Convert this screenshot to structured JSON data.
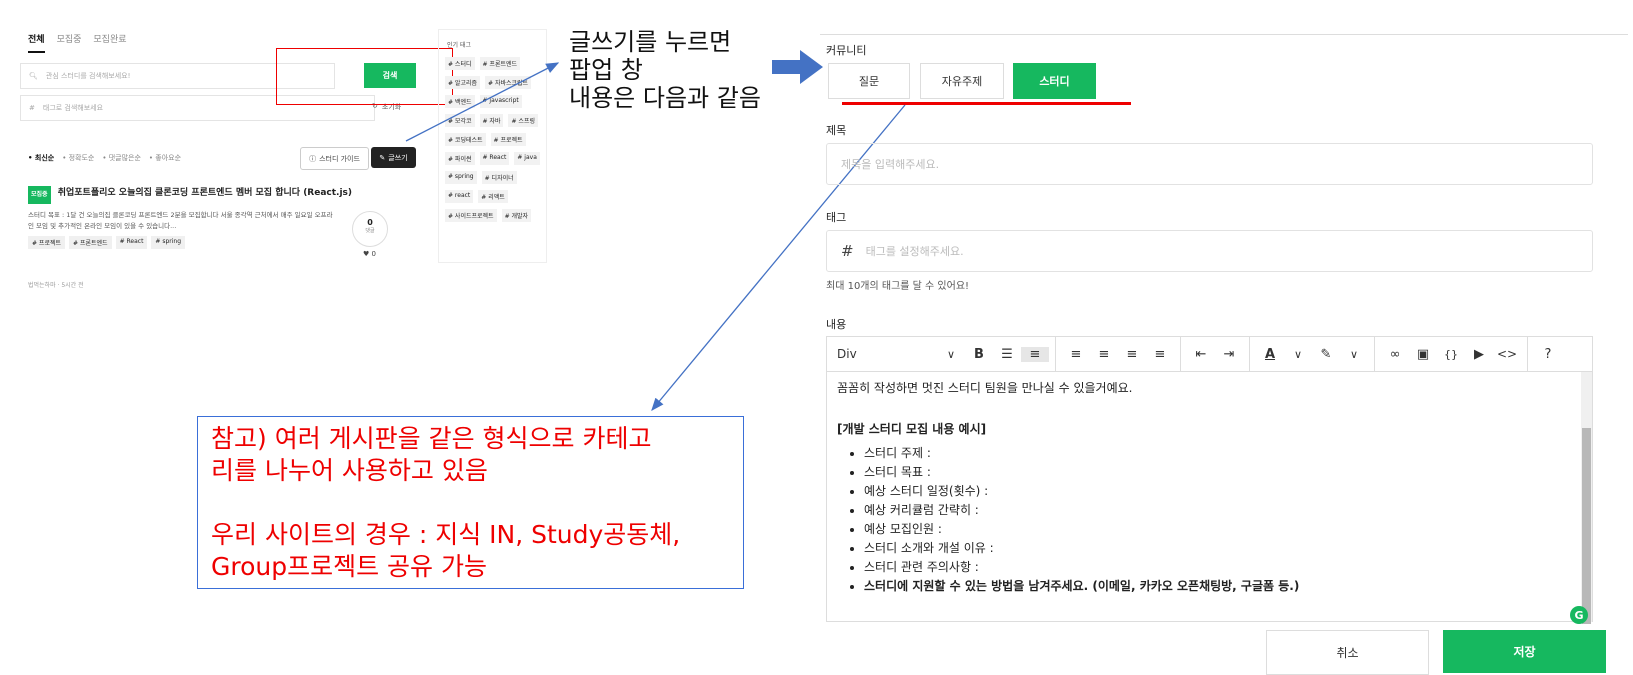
{
  "left": {
    "tabs": [
      "전체",
      "모집중",
      "모집완료"
    ],
    "search_placeholder": "관심 스터디를 검색해보세요!",
    "search_button": "검색",
    "tag_placeholder": "태그로 검색해보세요",
    "reset": "초기화",
    "sorts": [
      "• 최신순",
      "• 정확도순",
      "• 댓글많은순",
      "• 좋아요순"
    ],
    "guide_button": "스터디 가이드",
    "write_button": "글쓰기",
    "post": {
      "badge": "모집중",
      "title": "취업포트폴리오 오늘의집 클론코딩 프론트엔드 멤버 모집 합니다 (React.js)",
      "body": "스터디 목표 : 1달 건 오늘의집 클론코딩 프론트엔드 2분을 모집합니다 서울 종각역 근처에서 매주 일요일 오프라인 모임 및 추가적인 온라인 모임이 있을 수 있습니다...",
      "tags": [
        "# 프로젝트",
        "# 프론트엔드",
        "# React",
        "# spring"
      ],
      "comments_count": "0",
      "comments_label": "댓글",
      "likes": "0",
      "author": "법먹는하마 · 5시간 전"
    },
    "popular": {
      "title": "인기 태그",
      "tags": [
        "# 스터디",
        "# 프론트엔드",
        "# 알고리즘",
        "# 자바스크립트",
        "# 백엔드",
        "# javascript",
        "# 모각코",
        "# 자바",
        "# 스프링",
        "# 코딩테스트",
        "# 프로젝트",
        "# 파이썬",
        "# React",
        "# java",
        "# spring",
        "# 디자이너",
        "# react",
        "# 리액트",
        "# 사이드프로젝트",
        "# 개발자"
      ]
    }
  },
  "annotations": {
    "popup_note": "글쓰기를 누르면\n팝업 창\n내용은 다음과 같음",
    "note_box": "참고) 여러 게시판을 같은 형식으로 카테고\n리를 나누어 사용하고 있음\n\n우리 사이트의 경우 : 지식 IN, Study공동체,\nGroup프로젝트 공유 가능"
  },
  "editor_panel": {
    "community_label": "커뮤니티",
    "categories": [
      "질문",
      "자유주제",
      "스터디"
    ],
    "selected_category": "스터디",
    "title_label": "제목",
    "title_placeholder": "제목을 입력해주세요.",
    "tag_label": "태그",
    "tag_placeholder": "태그를 설정해주세요.",
    "tag_hint": "최대 10개의 태그를 달 수 있어요!",
    "content_label": "내용",
    "format_select": "Div",
    "intro_line": "꼼꼼히 작성하면 멋진 스터디 팀원을 만나실 수 있을거예요.",
    "example_heading": "[개발 스터디 모집 내용 예시]",
    "bullets": [
      "스터디 주제 :",
      "스터디 목표 :",
      "예상 스터디 일정(횟수) :",
      "예상 커리큘럼 간략히 :",
      "예상 모집인원 :",
      "스터디 소개와 개설 이유 :",
      "스터디 관련 주의사항 :"
    ],
    "bold_bullet": "스터디에 지원할 수 있는 방법을 남겨주세요. (이메일, 카카오 오픈채팅방, 구글폼 등.)",
    "cancel_button": "취소",
    "save_button": "저장"
  },
  "colors": {
    "accent": "#16b85f",
    "annotation_red": "#e00000",
    "arrow_blue": "#4472c4"
  }
}
